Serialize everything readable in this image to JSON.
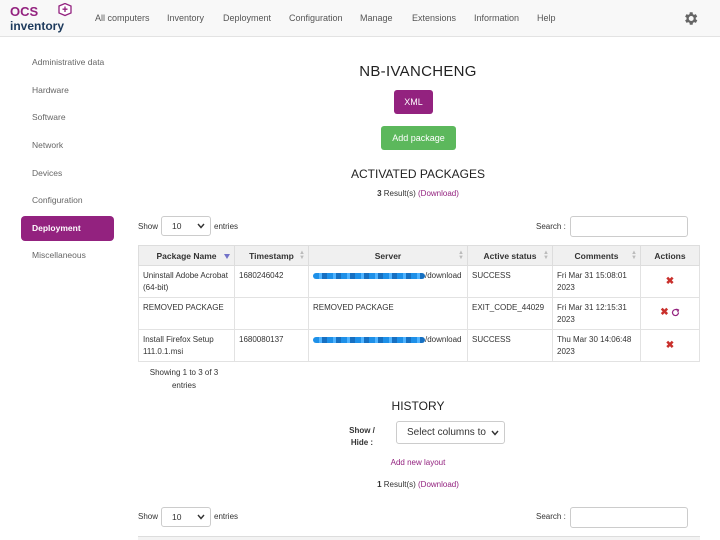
{
  "nav": {
    "logo_top": "OCS",
    "logo_bottom": "inventory",
    "items": [
      "All computers",
      "Inventory",
      "Deployment",
      "Configuration",
      "Manage",
      "Extensions",
      "Information",
      "Help"
    ],
    "settings_icon": "gear-icon"
  },
  "sidebar": {
    "items": [
      "Administrative data",
      "Hardware",
      "Software",
      "Network",
      "Devices",
      "Configuration",
      "Deployment",
      "Miscellaneous"
    ],
    "active": "Deployment"
  },
  "page": {
    "computer_name": "NB-IVANCHENG",
    "xml_button": "XML",
    "add_package_button": "Add package"
  },
  "activated": {
    "title": "ACTIVATED PACKAGES",
    "result_count": "3",
    "result_suffix": "Result(s)",
    "download_link": "(Download)",
    "show_label": "Show",
    "entries_value": "10",
    "entries_label": "entries",
    "search_label": "Search :",
    "columns": [
      "Package Name",
      "Timestamp",
      "Server",
      "Active status",
      "Comments",
      "Actions"
    ],
    "rows": [
      {
        "name": "Uninstall Adobe Acrobat (64-bit)",
        "timestamp": "1680246042",
        "server_suffix": "/download",
        "status": "SUCCESS",
        "comments": "Fri Mar 31 15:08:01 2023"
      },
      {
        "name": "REMOVED PACKAGE",
        "timestamp": "",
        "server_text": "REMOVED PACKAGE",
        "status": "EXIT_CODE_44029",
        "comments": "Fri Mar 31 12:15:31 2023"
      },
      {
        "name": "Install Firefox Setup 111.0.1.msi",
        "timestamp": "1680080137",
        "server_suffix": "/download",
        "status": "SUCCESS",
        "comments": "Thu Mar 30 14:06:48 2023"
      }
    ],
    "info": "Showing 1 to 3 of 3 entries"
  },
  "history": {
    "title": "HISTORY",
    "show_hide_label": "Show / Hide :",
    "columns_select": "Select columns to",
    "add_layout_link": "Add new layout",
    "result_count": "1",
    "result_suffix": "Result(s)",
    "download_link": "(Download)",
    "show_label": "Show",
    "entries_value": "10",
    "entries_label": "entries",
    "search_label": "Search :"
  },
  "colors": {
    "brand": "#93227f",
    "success": "#5cb85c",
    "danger": "#c9302c"
  }
}
